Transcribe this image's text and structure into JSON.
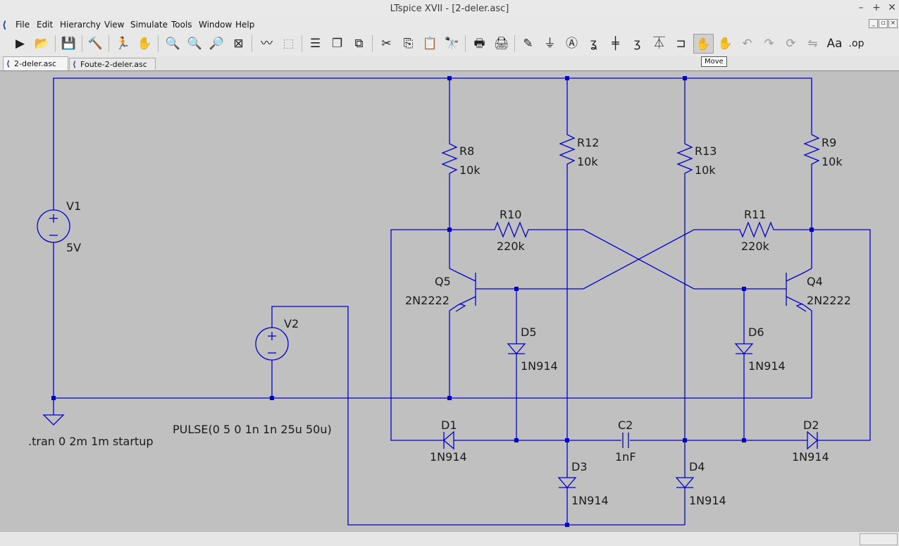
{
  "window": {
    "title": "LTspice XVII - [2-deler.asc]",
    "controls": [
      "–",
      "+",
      "✕"
    ]
  },
  "menu": [
    "File",
    "Edit",
    "Hierarchy",
    "View",
    "Simulate",
    "Tools",
    "Window",
    "Help"
  ],
  "tooltip": "Move",
  "tabs": [
    {
      "label": "2-deler.asc",
      "active": true
    },
    {
      "label": "Foute-2-deler.asc",
      "active": false
    }
  ],
  "schematic": {
    "wire_color": "#0000cc",
    "labels": {
      "r8_name": "R8",
      "r8_value": "10k",
      "r12_name": "R12",
      "r12_value": "10k",
      "r13_name": "R13",
      "r13_value": "10k",
      "r9_name": "R9",
      "r9_value": "10k",
      "r10_name": "R10",
      "r10_value": "220k",
      "r11_name": "R11",
      "r11_value": "220k",
      "v1_name": "V1",
      "v1_value": "5V",
      "v2_name": "V2",
      "v2_value": "PULSE(0 5 0 1n 1n 25u 50u)",
      "q5_name": "Q5",
      "q5_model": "2N2222",
      "q4_name": "Q4",
      "q4_model": "2N2222",
      "d5_name": "D5",
      "d5_model": "1N914",
      "d6_name": "D6",
      "d6_model": "1N914",
      "d1_name": "D1",
      "d1_model": "1N914",
      "d2_name": "D2",
      "d2_model": "1N914",
      "d3_name": "D3",
      "d3_model": "1N914",
      "d4_name": "D4",
      "d4_model": "1N914",
      "c2_name": "C2",
      "c2_value": "1nF",
      "directive": ".tran 0 2m 1m startup"
    }
  }
}
